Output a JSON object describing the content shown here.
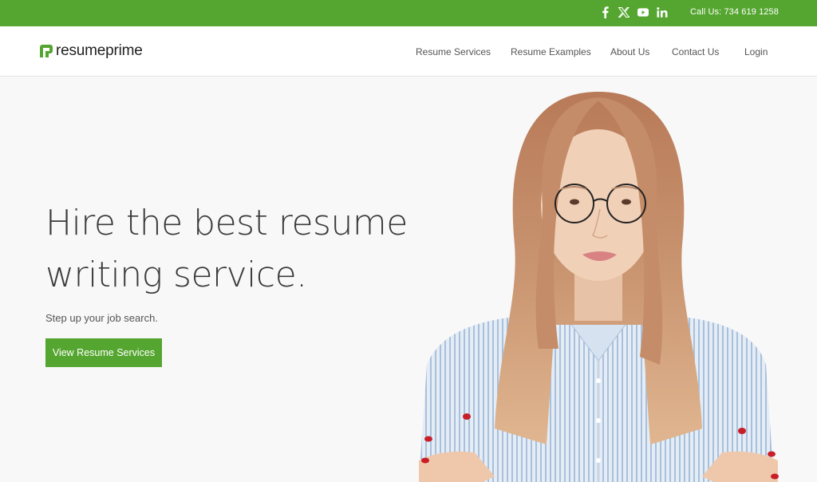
{
  "topbar": {
    "social": [
      {
        "name": "facebook-icon",
        "label": "Facebook"
      },
      {
        "name": "x-twitter-icon",
        "label": "X"
      },
      {
        "name": "youtube-icon",
        "label": "YouTube"
      },
      {
        "name": "linkedin-icon",
        "label": "LinkedIn"
      }
    ],
    "call_us": "Call Us: 734 619 1258"
  },
  "header": {
    "logo_text": "resumeprime",
    "nav": [
      {
        "label": "Resume Services"
      },
      {
        "label": "Resume Examples"
      },
      {
        "label": "About Us"
      },
      {
        "label": "Contact Us"
      },
      {
        "label": "Login"
      }
    ]
  },
  "hero": {
    "headline_line1": "Hire the best resume",
    "headline_line2": "writing service.",
    "subheadline": "Step up your job search.",
    "cta_label": "View Resume Services",
    "image_alt": "Smiling woman with glasses and striped shirt, arms crossed"
  },
  "colors": {
    "brand_green": "#55a630",
    "background": "#f8f8f8",
    "header_bg": "#ffffff",
    "text_dark": "#3a3a3a"
  }
}
